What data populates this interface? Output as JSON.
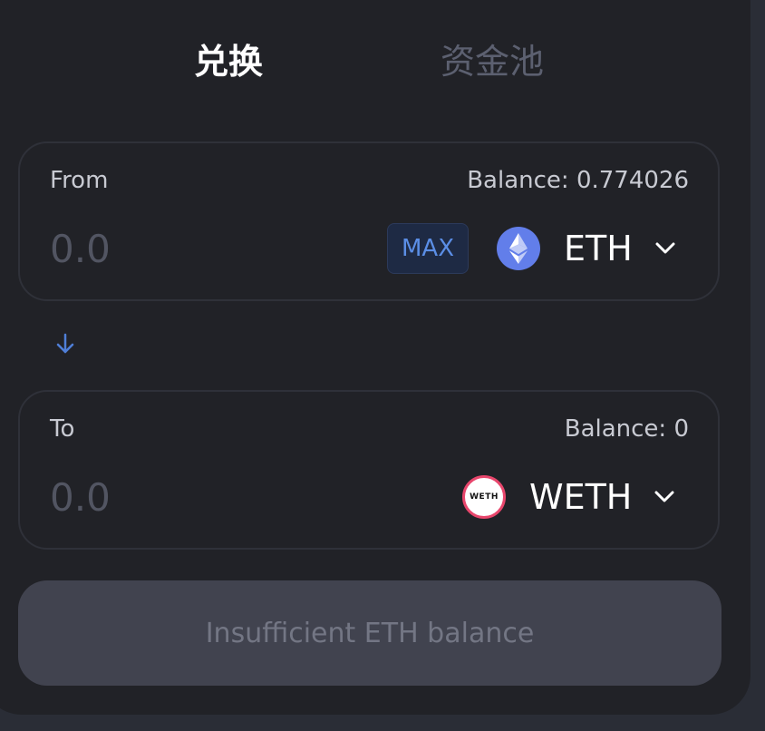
{
  "tabs": {
    "swap": "兑换",
    "pool": "资金池"
  },
  "from": {
    "label": "From",
    "balance": "Balance: 0.774026",
    "amount_placeholder": "0.0",
    "max_label": "MAX",
    "token_symbol": "ETH",
    "token_icon": "ethereum-icon"
  },
  "to": {
    "label": "To",
    "balance": "Balance: 0",
    "amount_placeholder": "0.0",
    "token_symbol": "WETH",
    "token_icon": "weth-icon",
    "token_logo_text": "WETH"
  },
  "switch_icon": "arrow-down-icon",
  "submit": {
    "label": "Insufficient ETH balance",
    "disabled": true
  },
  "colors": {
    "background": "#212227",
    "accent": "#5b8ee6",
    "eth_brand": "#627eea",
    "weth_brand": "#e8466c"
  }
}
